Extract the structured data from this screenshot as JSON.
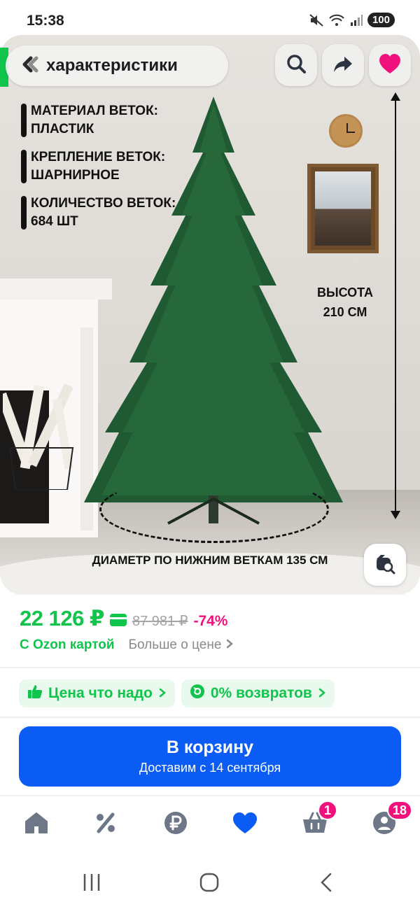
{
  "status_bar": {
    "time": "15:38",
    "battery": "100",
    "icons": [
      "mute-icon",
      "wifi-icon",
      "signal-icon"
    ]
  },
  "header": {
    "characteristics_label": "характеристики",
    "back_icon": "chevron-left-icon",
    "actions": [
      "search-icon",
      "share-icon",
      "heart-icon"
    ]
  },
  "product_image": {
    "specs": [
      "МАТЕРИАЛ ВЕТОК: ПЛАСТИК",
      "КРЕПЛЕНИЕ ВЕТОК: ШАРНИРНОЕ",
      "КОЛИЧЕСТВО ВЕТОК: 684 ШТ"
    ],
    "height_label": "ВЫСОТА 210 СМ",
    "diameter_label": "ДИАМЕТР ПО НИЖНИМ ВЕТКАМ 135 СМ",
    "lens_icon": "image-search-icon"
  },
  "price": {
    "current": "22 126 ₽",
    "old": "87 981 ₽",
    "discount": "-74%",
    "card_label": "С Ozon картой",
    "more_label": "Больше о цене"
  },
  "badges": [
    {
      "icon": "thumbs-up-icon",
      "label": "Цена что надо"
    },
    {
      "icon": "return-icon",
      "label": "0% возвратов"
    }
  ],
  "cart_button": {
    "title": "В корзину",
    "subtitle": "Доставим с 14 сентября"
  },
  "bottom_nav": {
    "items": [
      {
        "icon": "home-icon"
      },
      {
        "icon": "percent-icon"
      },
      {
        "icon": "ruble-icon"
      },
      {
        "icon": "heart-icon"
      },
      {
        "icon": "basket-icon",
        "badge": "1"
      },
      {
        "icon": "profile-icon",
        "badge": "18"
      }
    ]
  },
  "colors": {
    "accent_green": "#10c44c",
    "accent_pink": "#f1117e",
    "primary_blue": "#0a5cf5"
  }
}
